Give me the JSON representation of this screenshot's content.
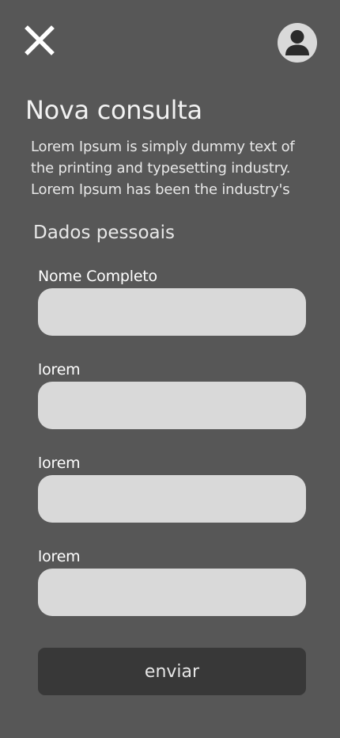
{
  "header": {
    "close_icon": "close-icon",
    "avatar_icon": "user-icon"
  },
  "page": {
    "title": "Nova consulta",
    "intro": "Lorem Ipsum is simply dummy text of the printing and typesetting industry. Lorem Ipsum has been the industry's"
  },
  "form": {
    "section_title": "Dados pessoais",
    "fields": [
      {
        "label": "Nome Completo",
        "value": "",
        "placeholder": ""
      },
      {
        "label": "lorem",
        "value": "",
        "placeholder": ""
      },
      {
        "label": "lorem",
        "value": "",
        "placeholder": ""
      },
      {
        "label": "lorem",
        "value": "",
        "placeholder": ""
      }
    ],
    "submit_label": "enviar"
  },
  "colors": {
    "background": "#575757",
    "input_fill": "#d9d9d9",
    "button_fill": "#383838",
    "text": "#ffffff"
  }
}
